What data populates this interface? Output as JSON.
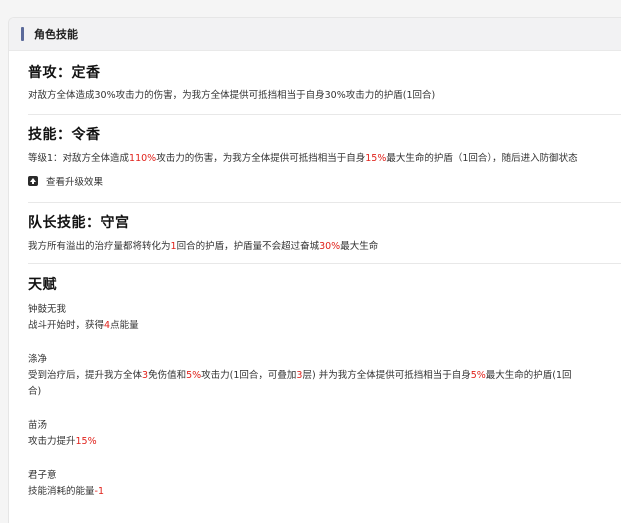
{
  "header": {
    "title": "角色技能"
  },
  "normal": {
    "title": "普攻：定香",
    "desc_parts": [
      "对敌方全体造成30%攻击力的伤害，为我方全体提供可抵挡相当于自身30%攻击力的护盾(1回合)"
    ]
  },
  "skill": {
    "title": "技能：令香",
    "desc_parts": [
      "等级1：对敌方全体造成",
      "110%",
      "攻击力的伤害，为我方全体提供可抵挡相当于自身",
      "15%",
      "最大生命的护盾（1回合），随后进入防御状态"
    ],
    "upgrade_label": "查看升级效果"
  },
  "leader": {
    "title": "队长技能：守宫",
    "desc_parts": [
      "我方所有溢出的治疗量都将转化为",
      "1",
      "回合的护盾，护盾量不会超过奋城",
      "30%",
      "最大生命"
    ]
  },
  "talent": {
    "title": "天赋",
    "items": [
      {
        "name": "钟鼓无我",
        "desc_parts": [
          "战斗开始时，获得",
          "4",
          "点能量"
        ]
      },
      {
        "name": "涤净",
        "desc_parts": [
          "受到治疗后，提升我方全体",
          "3",
          "免伤值和",
          "5%",
          "攻击力(1回合，可叠加",
          "3",
          "层) 并为我方全体提供可抵挡相当于自身",
          "5%",
          "最大生命的护盾(1回"
        ],
        "desc_line2": "合)"
      },
      {
        "name": "苗汤",
        "desc_parts": [
          "攻击力提升",
          "15%"
        ]
      },
      {
        "name": "君子意",
        "desc_parts": [
          "技能消耗的能量",
          "-1"
        ]
      }
    ]
  },
  "colors": {
    "highlight": "#e0221b",
    "accent_bar": "#5b6a9a"
  }
}
